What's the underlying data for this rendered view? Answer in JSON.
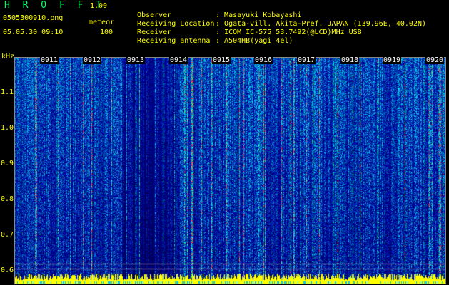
{
  "header": {
    "app_title": "H R O F F T",
    "version": "1.00",
    "filename": "0505300910.png",
    "mode": "meteor",
    "datetime": "05.05.30 09:10",
    "count": "100"
  },
  "station": [
    {
      "key": "Observer",
      "value": "Masayuki Kobayashi"
    },
    {
      "key": "Receiving Location",
      "value": "Ogata-vill. Akita-Pref. JAPAN (139.96E, 40.02N)"
    },
    {
      "key": "Receiver",
      "value": "ICOM IC-575 53.7492(@LCD)MHz USB"
    },
    {
      "key": "Receiving antenna",
      "value": "A504HB(yagi 4el)"
    }
  ],
  "spectrogram": {
    "y_unit": "kHz",
    "y_ticks": [
      "1.1",
      "1.0",
      "0.9",
      "0.8",
      "0.7",
      "0.6"
    ],
    "x_ticks": [
      "0911",
      "0912",
      "0913",
      "0914",
      "0915",
      "0916",
      "0917",
      "0918",
      "0919",
      "0920"
    ],
    "colors": {
      "low": "#000080",
      "mid": "#00c0ff",
      "high": "#ff0000",
      "baseline": "#ffff00"
    }
  }
}
